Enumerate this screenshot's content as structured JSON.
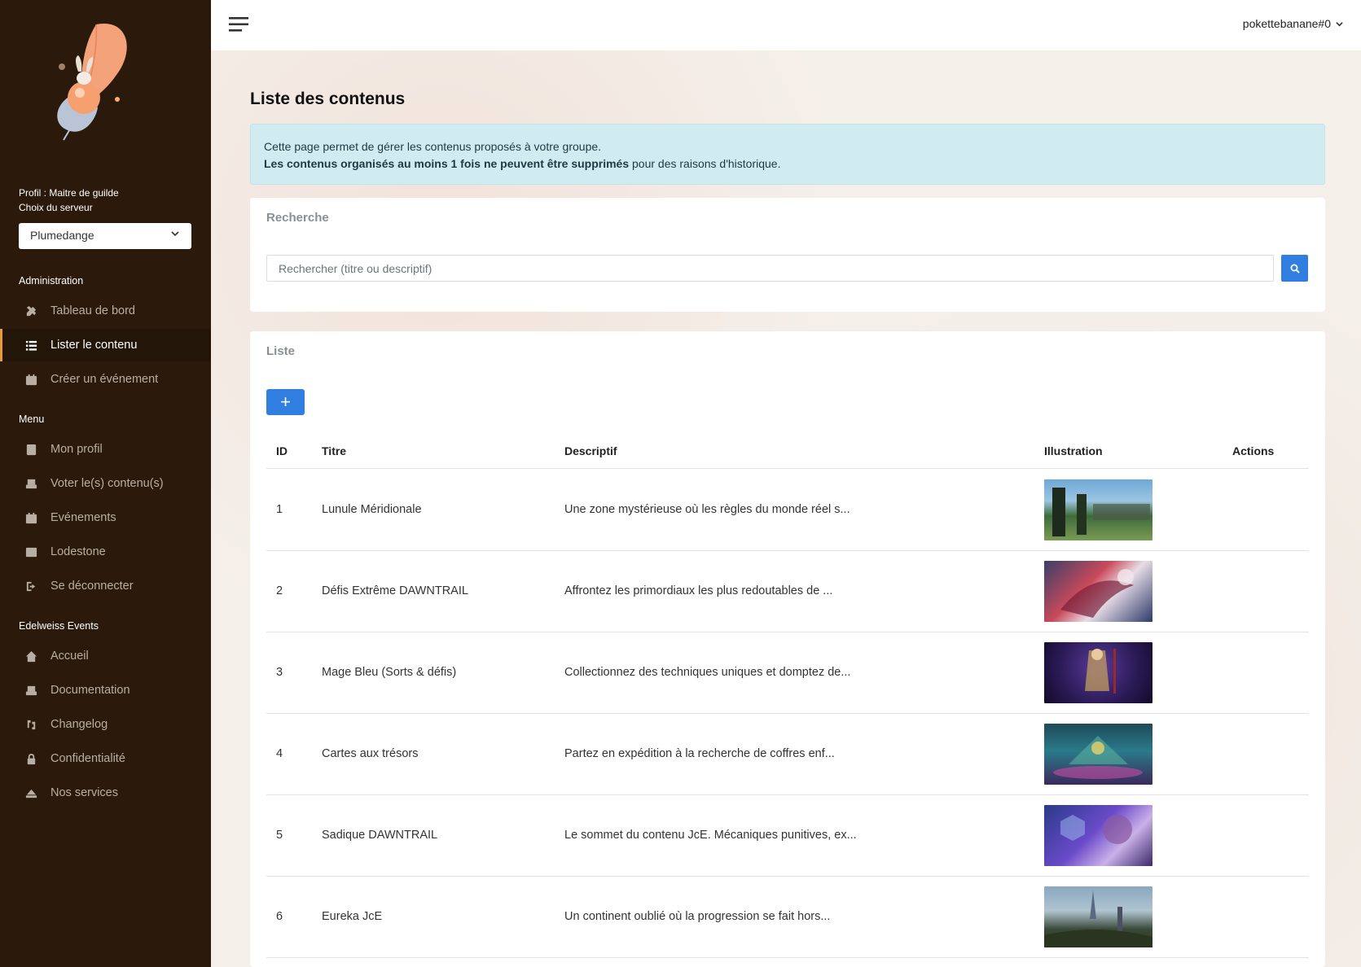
{
  "sidebar": {
    "profile_label": "Profil : Maitre de guilde",
    "server_label": "Choix du serveur",
    "server_value": "Plumedange",
    "sections": [
      {
        "title": "Administration",
        "items": [
          {
            "label": "Tableau de bord",
            "icon": "tools-icon"
          },
          {
            "label": "Lister le contenu",
            "icon": "list-icon",
            "active": true
          },
          {
            "label": "Créer un événement",
            "icon": "calendar-plus-icon"
          }
        ]
      },
      {
        "title": "Menu",
        "items": [
          {
            "label": "Mon profil",
            "icon": "id-card-icon"
          },
          {
            "label": "Voter le(s) contenu(s)",
            "icon": "vote-box-icon"
          },
          {
            "label": "Evénements",
            "icon": "calendar-icon"
          },
          {
            "label": "Lodestone",
            "icon": "newspaper-icon"
          },
          {
            "label": "Se déconnecter",
            "icon": "logout-icon"
          }
        ]
      },
      {
        "title": "Edelweiss Events",
        "items": [
          {
            "label": "Accueil",
            "icon": "home-icon"
          },
          {
            "label": "Documentation",
            "icon": "book-icon"
          },
          {
            "label": "Changelog",
            "icon": "changelog-icon"
          },
          {
            "label": "Confidentialité",
            "icon": "lock-icon"
          },
          {
            "label": "Nos services",
            "icon": "services-icon"
          }
        ]
      }
    ]
  },
  "header": {
    "username": "pokettebanane#0"
  },
  "main": {
    "title": "Liste des contenus",
    "alert": {
      "line1": "Cette page permet de gérer les contenus proposés à votre groupe.",
      "line2_bold": "Les contenus organisés au moins 1 fois ne peuvent être supprimés",
      "line2_rest": " pour des raisons d'historique."
    },
    "search": {
      "title": "Recherche",
      "placeholder": "Rechercher (titre ou descriptif)"
    },
    "list": {
      "title": "Liste",
      "add_label": "+",
      "columns": [
        "ID",
        "Titre",
        "Descriptif",
        "Illustration",
        "Actions"
      ],
      "rows": [
        {
          "id": "1",
          "title": "Lunule Méridionale",
          "desc": "Une zone mystérieuse où les règles du monde réel s..."
        },
        {
          "id": "2",
          "title": "Défis Extrême DAWNTRAIL",
          "desc": "Affrontez les primordiaux les plus redoutables de ..."
        },
        {
          "id": "3",
          "title": "Mage Bleu (Sorts & défis)",
          "desc": "Collectionnez des techniques uniques et domptez de..."
        },
        {
          "id": "4",
          "title": "Cartes aux trésors",
          "desc": "Partez en expédition à la recherche de coffres enf..."
        },
        {
          "id": "5",
          "title": "Sadique DAWNTRAIL",
          "desc": "Le sommet du contenu JcE. Mécaniques punitives, ex..."
        },
        {
          "id": "6",
          "title": "Eureka JcE",
          "desc": "Un continent oublié où la progression se fait hors..."
        }
      ]
    }
  },
  "colors": {
    "sidebar_bg": "#2b1a0b",
    "accent_orange": "#e69a3c",
    "primary_blue": "#2f7ee0",
    "alert_bg": "#d1ecf1"
  }
}
